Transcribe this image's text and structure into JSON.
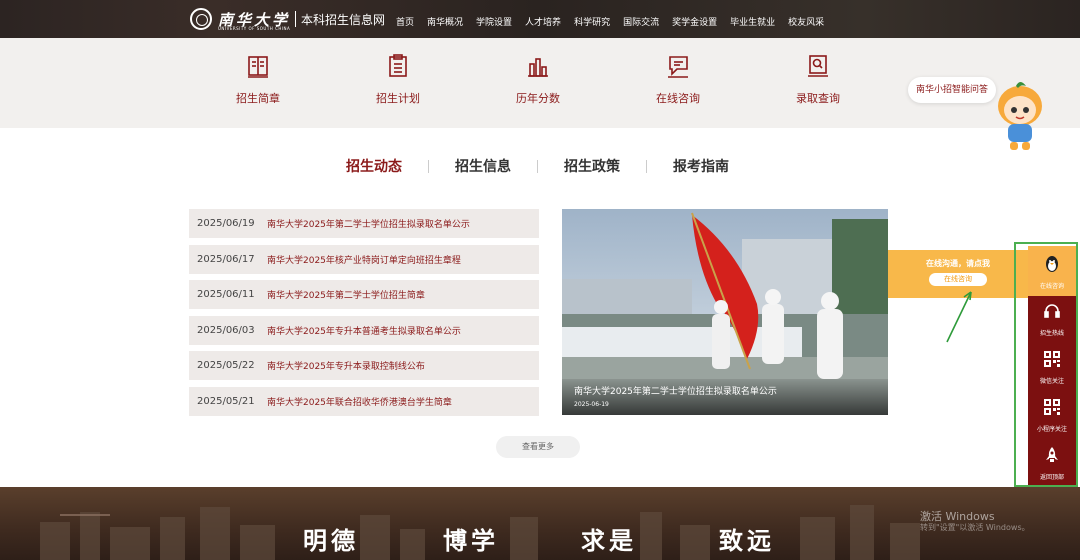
{
  "header": {
    "logo_text": "南华大学",
    "logo_english": "UNIVERSITY OF SOUTH CHINA",
    "site_title": "本科招生信息网",
    "nav": [
      "首页",
      "南华概况",
      "学院设置",
      "人才培养",
      "科学研究",
      "国际交流",
      "奖学金设置",
      "毕业生就业",
      "校友风采"
    ]
  },
  "quick_links": [
    {
      "label": "招生简章",
      "icon": "book-icon"
    },
    {
      "label": "招生计划",
      "icon": "clipboard-icon"
    },
    {
      "label": "历年分数",
      "icon": "bar-chart-icon"
    },
    {
      "label": "在线咨询",
      "icon": "chat-icon"
    },
    {
      "label": "录取查询",
      "icon": "search-document-icon"
    }
  ],
  "mascot_bubble": "南华小招智能问答",
  "tabs": [
    "招生动态",
    "招生信息",
    "招生政策",
    "报考指南"
  ],
  "news": [
    {
      "date": "2025/06/19",
      "title": "南华大学2025年第二学士学位招生拟录取名单公示"
    },
    {
      "date": "2025/06/17",
      "title": "南华大学2025年核产业特岗订单定向班招生章程"
    },
    {
      "date": "2025/06/11",
      "title": "南华大学2025年第二学士学位招生简章"
    },
    {
      "date": "2025/06/03",
      "title": "南华大学2025年专升本普通考生拟录取名单公示"
    },
    {
      "date": "2025/05/22",
      "title": "南华大学2025年专升本录取控制线公布"
    },
    {
      "date": "2025/05/21",
      "title": "南华大学2025年联合招收华侨港澳台学生简章"
    }
  ],
  "featured": {
    "title": "南华大学2025年第二学士学位招生拟录取名单公示",
    "date": "2025-06-19"
  },
  "more_label": "查看更多",
  "consult": {
    "text": "在线沟通，请点我",
    "button": "在线咨询"
  },
  "sidebar": [
    {
      "label": "在线咨询",
      "icon": "penguin-icon"
    },
    {
      "label": "招生热线",
      "icon": "headset-icon"
    },
    {
      "label": "微信关注",
      "icon": "qr-code-icon"
    },
    {
      "label": "小程序关注",
      "icon": "qr-code-icon"
    },
    {
      "label": "返回顶部",
      "icon": "rocket-icon"
    }
  ],
  "motto": [
    "明德",
    "博学",
    "求是",
    "致远"
  ],
  "watermark": {
    "title": "激活 Windows",
    "sub": "转到\"设置\"以激活 Windows。"
  },
  "colors": {
    "brand": "#8b1a1a",
    "accent": "#f8b84a",
    "sidebar": "#7c1010"
  }
}
